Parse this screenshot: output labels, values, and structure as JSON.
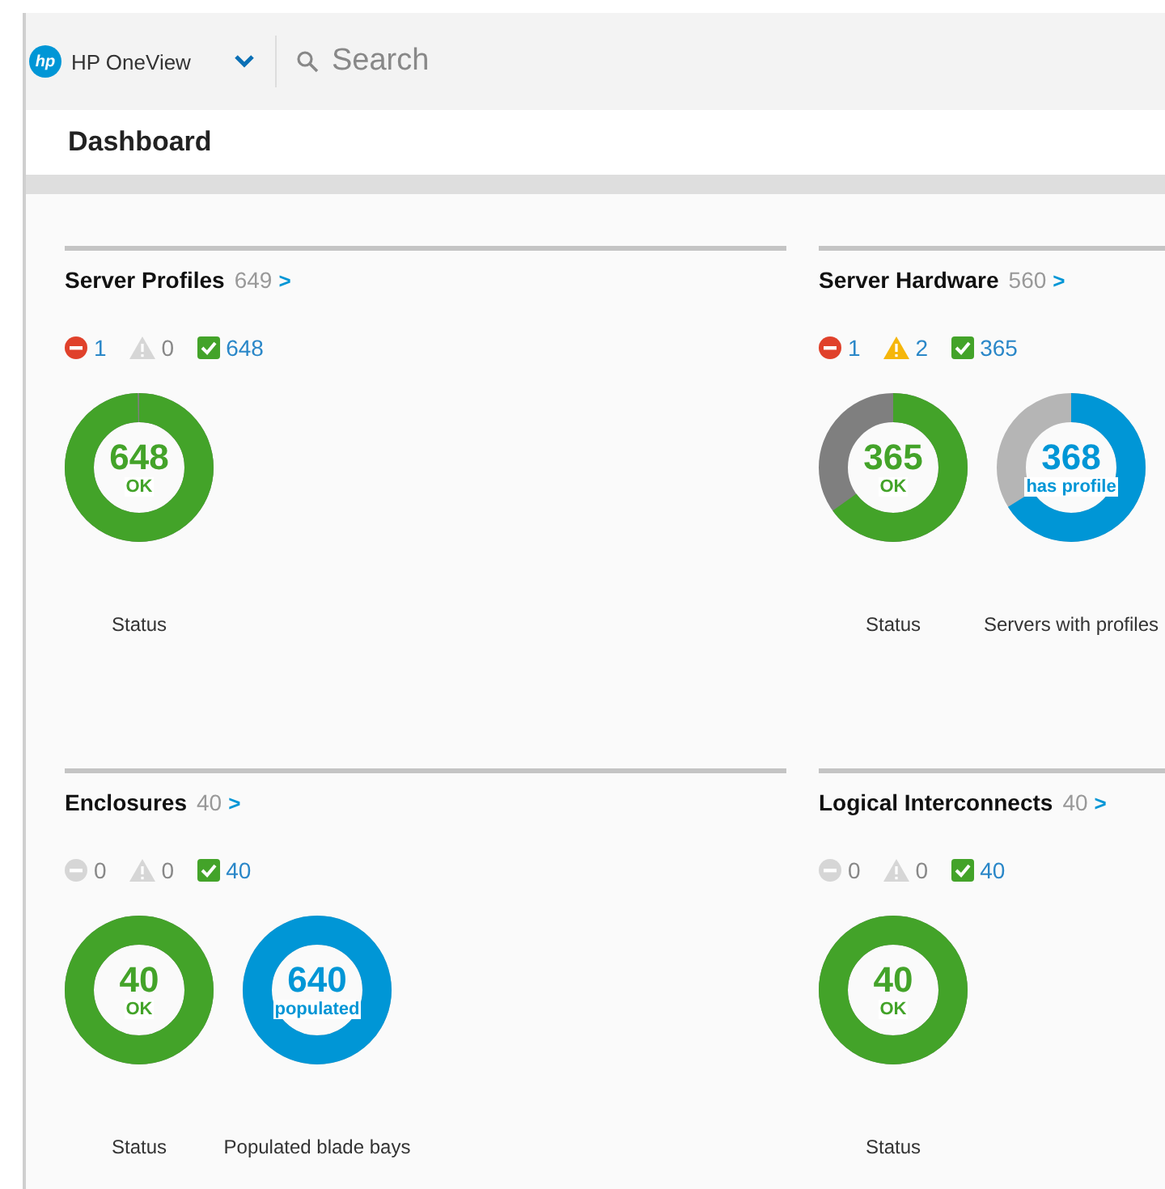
{
  "topbar": {
    "logo": "hp",
    "app_name": "HP OneView",
    "search": {
      "placeholder": "Search"
    }
  },
  "page_title": "Dashboard",
  "panels": [
    {
      "title": "Server Profiles",
      "count": "649",
      "link": ">",
      "statuses": [
        {
          "kind": "error",
          "count": "1",
          "active": true
        },
        {
          "kind": "warning",
          "count": "0",
          "active": false
        },
        {
          "kind": "ok",
          "count": "648",
          "active": true
        }
      ],
      "donuts": [
        {
          "kind": "status",
          "value": "648",
          "label": "OK",
          "level": 0.995,
          "caption": "Status"
        }
      ]
    },
    {
      "title": "Server Hardware",
      "count": "560",
      "link": ">",
      "statuses": [
        {
          "kind": "error",
          "count": "1",
          "active": true
        },
        {
          "kind": "warning",
          "count": "2",
          "active": true
        },
        {
          "kind": "ok",
          "count": "365",
          "active": true
        }
      ],
      "donuts": [
        {
          "kind": "status",
          "value": "365",
          "label": "OK",
          "level": 0.65,
          "caption": "Status"
        },
        {
          "kind": "count",
          "value": "368",
          "label": "has profile",
          "level": 0.66,
          "caption": "Servers with profiles"
        }
      ]
    },
    {
      "title": "Enclosures",
      "count": "40",
      "link": ">",
      "statuses": [
        {
          "kind": "error",
          "count": "0",
          "active": false
        },
        {
          "kind": "warning",
          "count": "0",
          "active": false
        },
        {
          "kind": "ok",
          "count": "40",
          "active": true
        }
      ],
      "donuts": [
        {
          "kind": "status",
          "value": "40",
          "label": "OK",
          "level": 1,
          "caption": "Status"
        },
        {
          "kind": "count",
          "value": "640",
          "label": "populated",
          "level": 1,
          "caption": "Populated blade bays"
        }
      ]
    },
    {
      "title": "Logical Interconnects",
      "count": "40",
      "link": ">",
      "statuses": [
        {
          "kind": "error",
          "count": "0",
          "active": false
        },
        {
          "kind": "warning",
          "count": "0",
          "active": false
        },
        {
          "kind": "ok",
          "count": "40",
          "active": true
        }
      ],
      "donuts": [
        {
          "kind": "status",
          "value": "40",
          "label": "OK",
          "level": 1,
          "caption": "Status"
        }
      ]
    }
  ]
}
